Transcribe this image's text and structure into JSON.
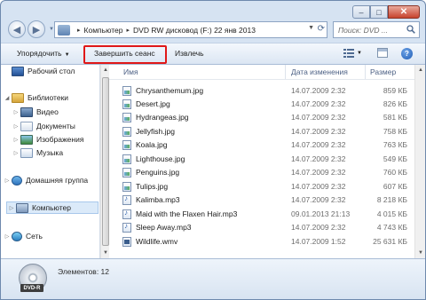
{
  "window": {
    "caption": {
      "minimize": "–",
      "maximize": "□",
      "close": "✕"
    }
  },
  "address": {
    "parts": [
      "Компьютер",
      "DVD RW дисковод (F:) 22 янв 2013"
    ],
    "separator": "▸",
    "search_placeholder": "Поиск: DVD ..."
  },
  "toolbar": {
    "organize": "Упорядочить",
    "burn_finish": "Завершить сеанс",
    "eject": "Извлечь"
  },
  "navpane": {
    "items": [
      {
        "label": "Рабочий стол",
        "icon": "desktop-icon"
      },
      {
        "label": "Библиотеки",
        "icon": "libraries-icon"
      },
      {
        "label": "Видео",
        "icon": "video-icon"
      },
      {
        "label": "Документы",
        "icon": "documents-icon"
      },
      {
        "label": "Изображения",
        "icon": "pictures-icon"
      },
      {
        "label": "Музыка",
        "icon": "music-icon"
      },
      {
        "label": "Домашняя группа",
        "icon": "homegroup-icon"
      },
      {
        "label": "Компьютер",
        "icon": "computer-icon",
        "selected": true
      },
      {
        "label": "Сеть",
        "icon": "network-icon"
      }
    ]
  },
  "filelist": {
    "columns": {
      "name": "Имя",
      "date": "Дата изменения",
      "size": "Размер"
    },
    "rows": [
      {
        "name": "Chrysanthemum.jpg",
        "date": "14.07.2009 2:32",
        "size": "859 КБ",
        "type": "img"
      },
      {
        "name": "Desert.jpg",
        "date": "14.07.2009 2:32",
        "size": "826 КБ",
        "type": "img"
      },
      {
        "name": "Hydrangeas.jpg",
        "date": "14.07.2009 2:32",
        "size": "581 КБ",
        "type": "img"
      },
      {
        "name": "Jellyfish.jpg",
        "date": "14.07.2009 2:32",
        "size": "758 КБ",
        "type": "img"
      },
      {
        "name": "Koala.jpg",
        "date": "14.07.2009 2:32",
        "size": "763 КБ",
        "type": "img"
      },
      {
        "name": "Lighthouse.jpg",
        "date": "14.07.2009 2:32",
        "size": "549 КБ",
        "type": "img"
      },
      {
        "name": "Penguins.jpg",
        "date": "14.07.2009 2:32",
        "size": "760 КБ",
        "type": "img"
      },
      {
        "name": "Tulips.jpg",
        "date": "14.07.2009 2:32",
        "size": "607 КБ",
        "type": "img"
      },
      {
        "name": "Kalimba.mp3",
        "date": "14.07.2009 2:32",
        "size": "8 218 КБ",
        "type": "snd"
      },
      {
        "name": "Maid with the Flaxen Hair.mp3",
        "date": "09.01.2013 21:13",
        "size": "4 015 КБ",
        "type": "snd"
      },
      {
        "name": "Sleep Away.mp3",
        "date": "14.07.2009 2:32",
        "size": "4 743 КБ",
        "type": "snd"
      },
      {
        "name": "Wildlife.wmv",
        "date": "14.07.2009 1:52",
        "size": "25 631 КБ",
        "type": "vid"
      }
    ]
  },
  "details": {
    "drive_badge": "DVD-R",
    "count_label": "Элементов: 12"
  }
}
